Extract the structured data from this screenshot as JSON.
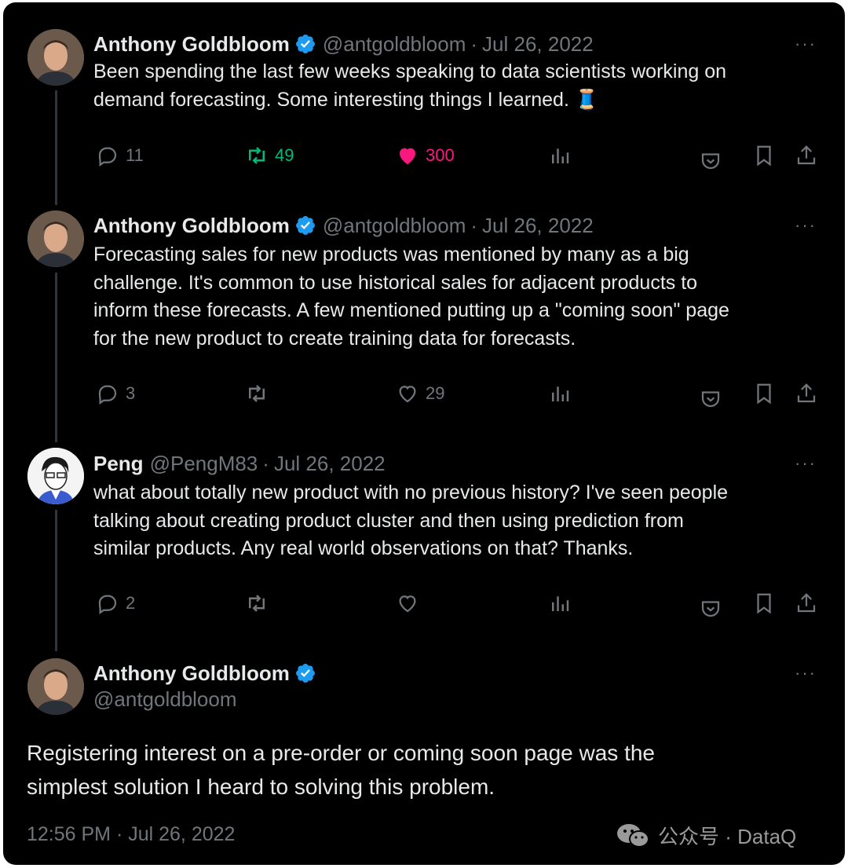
{
  "tweets": [
    {
      "name": "Anthony Goldbloom",
      "handle": "@antgoldbloom",
      "sep": "·",
      "date": "Jul 26, 2022",
      "more": "···",
      "text_lines": [
        "Been spending the last few weeks speaking to data scientists working on",
        "demand forecasting. Some interesting things I learned. 🧵"
      ],
      "replies": "11",
      "retweets": "49",
      "likes": "300"
    },
    {
      "name": "Anthony Goldbloom",
      "handle": "@antgoldbloom",
      "sep": "·",
      "date": "Jul 26, 2022",
      "more": "···",
      "text_lines": [
        "Forecasting sales for new products was mentioned by many as a big",
        "challenge. It's common to use historical sales for adjacent products to",
        "inform these forecasts. A few mentioned putting up a \"coming soon\" page",
        "for the new product to create training data for forecasts."
      ],
      "replies": "3",
      "retweets": "",
      "likes": "29"
    },
    {
      "name": "Peng",
      "handle": "@PengM83",
      "sep": "·",
      "date": "Jul 26, 2022",
      "more": "···",
      "text_lines": [
        "what about totally new product with no previous history? I've seen people",
        "talking about creating product cluster and then using prediction from",
        "similar products. Any real world observations on that? Thanks."
      ],
      "replies": "2",
      "retweets": "",
      "likes": ""
    }
  ],
  "main_tweet": {
    "name": "Anthony Goldbloom",
    "handle": "@antgoldbloom",
    "more": "···",
    "text_lines": [
      "Registering interest on a pre-order or coming soon page was the",
      "simplest solution I heard to solving this problem."
    ],
    "timestamp": "12:56 PM · Jul 26, 2022"
  },
  "watermark": {
    "text": "公众号 · DataQ"
  },
  "colors": {
    "background": "#000000",
    "text": "#e7e9ea",
    "muted": "#71767b",
    "retweet_active": "#00ba7c",
    "like_active": "#f91880",
    "verified": "#1d9bf0"
  }
}
